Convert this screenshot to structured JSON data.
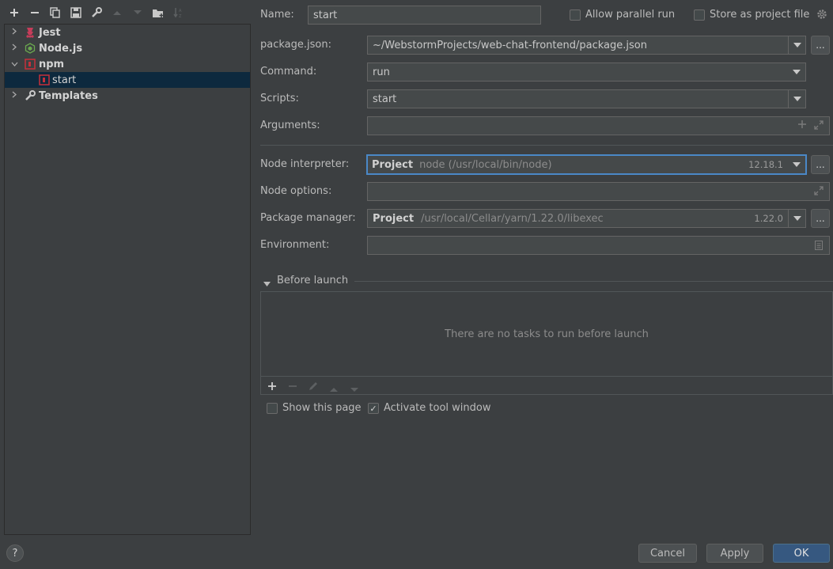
{
  "toolbar": {
    "icons": [
      "plus-icon",
      "minus-icon",
      "copy-icon",
      "save-icon",
      "wrench-icon",
      "arrow-up-icon",
      "arrow-down-icon",
      "folder-add-icon",
      "sort-icon"
    ]
  },
  "tree": {
    "items": [
      {
        "label": "Jest",
        "icon": "jest-icon",
        "expanded": false
      },
      {
        "label": "Node.js",
        "icon": "nodejs-icon",
        "expanded": false
      },
      {
        "label": "npm",
        "icon": "npm-icon",
        "expanded": true
      },
      {
        "label": "start",
        "icon": "npm-icon",
        "selected": true
      },
      {
        "label": "Templates",
        "icon": "wrench-icon",
        "expanded": false
      }
    ]
  },
  "form": {
    "name_label": "Name:",
    "name_value": "start",
    "allow_parallel_label": "Allow parallel run",
    "store_project_label": "Store as project file",
    "package_json_label": "package.json:",
    "package_json_value": "~/WebstormProjects/web-chat-frontend/package.json",
    "command_label": "Command:",
    "command_value": "run",
    "scripts_label": "Scripts:",
    "scripts_value": "start",
    "arguments_label": "Arguments:",
    "node_interpreter_label": "Node interpreter:",
    "node_interpreter_kind": "Project",
    "node_interpreter_path": "node (/usr/local/bin/node)",
    "node_interpreter_version": "12.18.1",
    "node_options_label": "Node options:",
    "package_manager_label": "Package manager:",
    "package_manager_kind": "Project",
    "package_manager_path": "/usr/local/Cellar/yarn/1.22.0/libexec",
    "package_manager_version": "1.22.0",
    "environment_label": "Environment:",
    "ellipsis": "..."
  },
  "before_launch": {
    "title": "Before launch",
    "empty_text": "There are no tasks to run before launch"
  },
  "options": {
    "show_page_label": "Show this page",
    "show_page_checked": false,
    "activate_tool_label": "Activate tool window",
    "activate_tool_checked": true
  },
  "footer": {
    "help": "?",
    "cancel": "Cancel",
    "apply": "Apply",
    "ok": "OK"
  },
  "colors": {
    "background": "#3c3f41",
    "selection": "#0d293e",
    "primary_button": "#365880",
    "focus_border": "#4a88c7",
    "npm_red": "#c7303a"
  }
}
